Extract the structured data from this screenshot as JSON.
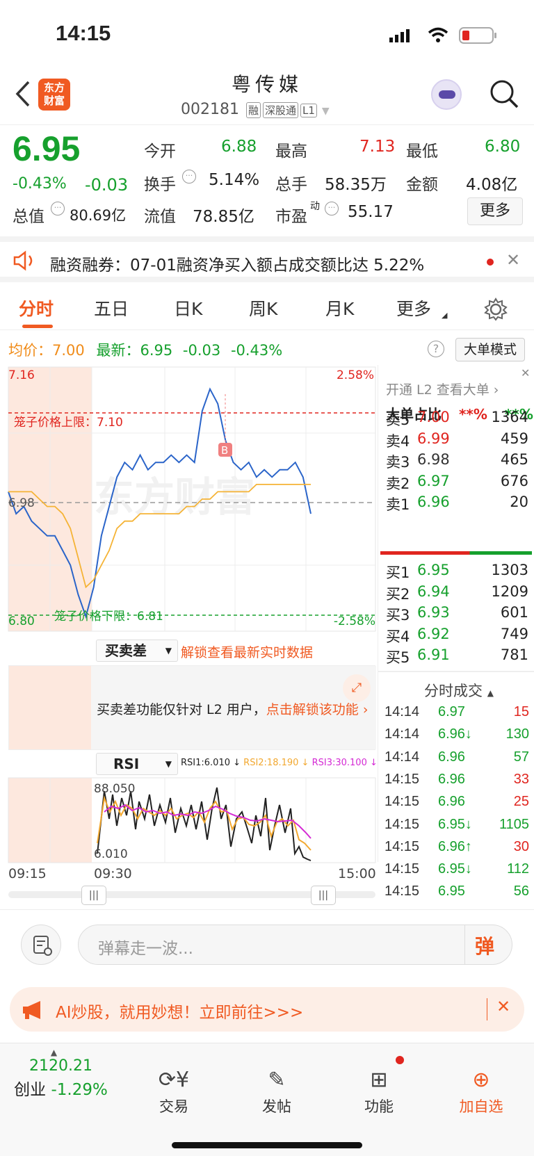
{
  "status": {
    "time": "14:15"
  },
  "header": {
    "back_icon": "chevron-left-icon",
    "logo_text": "东方\n财富",
    "title": "粤传媒",
    "code": "002181",
    "tags": [
      "融",
      "深股通",
      "L1"
    ]
  },
  "quote": {
    "price": "6.95",
    "pct": "-0.43%",
    "chg": "-0.03",
    "open_label": "今开",
    "open": "6.88",
    "high_label": "最高",
    "high": "7.13",
    "low_label": "最低",
    "low": "6.80",
    "turnover_label": "换手",
    "turnover": "5.14%",
    "vol_label": "总手",
    "vol": "58.35万",
    "amt_label": "金额",
    "amt": "4.08亿",
    "mcap_label": "总值",
    "mcap": "80.69亿",
    "float_label": "流值",
    "float": "78.85亿",
    "pe_label": "市盈",
    "pe_sup": "动",
    "pe": "55.17",
    "more": "更多"
  },
  "banner": {
    "text": "融资融券：07-01融资净买入额占成交额比达 5.22%"
  },
  "tabs": [
    "分时",
    "五日",
    "日K",
    "周K",
    "月K",
    "更多"
  ],
  "chart_info": {
    "avg_label": "均价：",
    "avg": "7.00",
    "latest_label": "最新：",
    "latest": "6.95",
    "chg": "-0.03",
    "pct": "-0.43%",
    "mode_btn": "大单模式"
  },
  "chart_data": {
    "type": "line",
    "ylim": [
      6.8,
      7.16
    ],
    "y_ticks": [
      "7.16",
      "6.98",
      "6.80"
    ],
    "pct_ticks": [
      "2.58%",
      "-2.58%"
    ],
    "upper_limit_label": "笼子价格上限：7.10",
    "lower_limit_label": "笼子价格下限：6.81",
    "x_ticks": [
      "09:15",
      "09:30",
      "15:00"
    ],
    "series": [
      {
        "values": [
          6.99,
          6.96,
          6.97,
          6.95,
          6.94,
          6.93,
          6.93,
          6.91,
          6.89,
          6.85,
          6.82,
          6.86,
          6.93,
          6.97,
          7.01,
          7.03,
          7.02,
          7.04,
          7.02,
          7.03,
          7.03,
          7.04,
          7.03,
          7.04,
          7.03,
          7.1,
          7.13,
          7.11,
          7.06,
          7.03,
          7.02,
          7.03,
          7.01,
          7.02,
          7.01,
          7.02,
          7.02,
          7.03,
          7.01,
          6.96
        ]
      },
      {
        "values": [
          6.99,
          6.99,
          6.99,
          6.99,
          6.98,
          6.97,
          6.97,
          6.96,
          6.94,
          6.9,
          6.86,
          6.87,
          6.89,
          6.91,
          6.94,
          6.95,
          6.95,
          6.96,
          6.96,
          6.96,
          6.96,
          6.96,
          6.96,
          6.97,
          6.97,
          6.98,
          6.98,
          6.99,
          6.99,
          6.99,
          6.99,
          6.99,
          7.0,
          7.0,
          7.0,
          7.0,
          7.0,
          7.0,
          7.0,
          7.0
        ]
      }
    ]
  },
  "side": {
    "l2_link": "开通 L2 查看大单",
    "big_ratio": "大单占比",
    "red_ratio": "**%",
    "green_ratio": "**%",
    "asks": [
      [
        "卖5",
        "7.00",
        "1364",
        "red"
      ],
      [
        "卖4",
        "6.99",
        "459",
        "red"
      ],
      [
        "卖3",
        "6.98",
        "465",
        "gray"
      ],
      [
        "卖2",
        "6.97",
        "676",
        "green"
      ],
      [
        "卖1",
        "6.96",
        "20",
        "green"
      ]
    ],
    "bids": [
      [
        "买1",
        "6.95",
        "1303",
        "green"
      ],
      [
        "买2",
        "6.94",
        "1209",
        "green"
      ],
      [
        "买3",
        "6.93",
        "601",
        "green"
      ],
      [
        "买4",
        "6.92",
        "749",
        "green"
      ],
      [
        "买5",
        "6.91",
        "781",
        "green"
      ]
    ],
    "ticks_title": "分时成交",
    "ticks": [
      [
        "14:14",
        "6.97",
        "15",
        "red"
      ],
      [
        "14:14",
        "6.96↓",
        "130",
        "green"
      ],
      [
        "14:14",
        "6.96",
        "57",
        "green"
      ],
      [
        "14:15",
        "6.96",
        "33",
        "red"
      ],
      [
        "14:15",
        "6.96",
        "25",
        "red"
      ],
      [
        "14:15",
        "6.95↓",
        "1105",
        "green"
      ],
      [
        "14:15",
        "6.96↑",
        "30",
        "red"
      ],
      [
        "14:15",
        "6.95↓",
        "112",
        "green"
      ],
      [
        "14:15",
        "6.95",
        "56",
        "green"
      ]
    ]
  },
  "buysell": {
    "label": "买卖差",
    "unlock": "解锁查看最新实时数据",
    "msg": "买卖差功能仅针对 L2 用户，",
    "msg_link": "点击解锁该功能"
  },
  "rsi": {
    "label": "RSI",
    "rsi1": "RSI1:6.010 ↓",
    "rsi2": "RSI2:18.190 ↓",
    "rsi3": "RSI3:30.100 ↓",
    "top": "88.050",
    "bottom": "6.010"
  },
  "comment": {
    "placeholder": "弹幕走一波...",
    "danmu": "弹"
  },
  "ad": {
    "text": "AI炒股，就用妙想！立即前往>>>"
  },
  "nav": {
    "index_val": "2120.21",
    "index_label": "创业",
    "index_pct": "-1.29%",
    "trade": "交易",
    "post": "发帖",
    "func": "功能",
    "add": "加自选"
  }
}
